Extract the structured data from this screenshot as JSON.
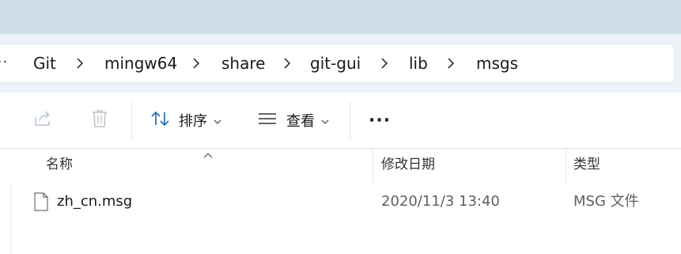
{
  "breadcrumb": {
    "overflow": "···",
    "items": [
      "Git",
      "mingw64",
      "share",
      "git-gui",
      "lib",
      "msgs"
    ]
  },
  "toolbar": {
    "share_icon": "share-icon",
    "delete_icon": "trash-icon",
    "sort_label": "排序",
    "view_label": "查看",
    "more_label": "···"
  },
  "columns": {
    "name": "名称",
    "date": "修改日期",
    "type": "类型"
  },
  "files": [
    {
      "name": "zh_cn.msg",
      "date": "2020/11/3 13:40",
      "type": "MSG 文件"
    }
  ]
}
